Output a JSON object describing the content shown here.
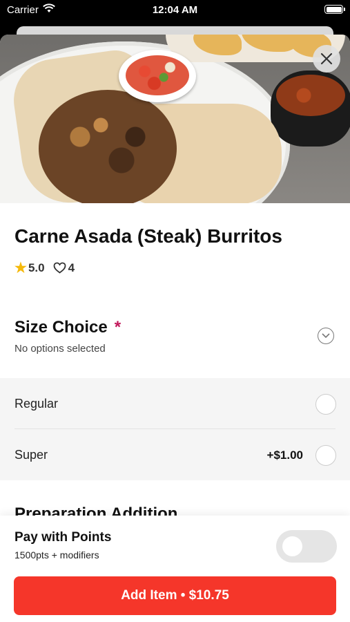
{
  "status_bar": {
    "carrier": "Carrier",
    "time": "12:04 AM"
  },
  "item": {
    "title": "Carne Asada (Steak) Burritos",
    "rating": "5.0",
    "likes": "4"
  },
  "size_choice": {
    "title": "Size Choice",
    "required_marker": "*",
    "subtitle": "No options selected",
    "options": [
      {
        "label": "Regular",
        "price": ""
      },
      {
        "label": "Super",
        "price": "+$1.00"
      }
    ]
  },
  "next_section": {
    "title": "Preparation Addition"
  },
  "pay_with_points": {
    "title": "Pay with Points",
    "subtitle": "1500pts + modifiers",
    "enabled": false
  },
  "add_button": {
    "label": "Add Item • $10.75"
  },
  "colors": {
    "accent": "#f5362a",
    "required": "#c2185b",
    "star": "#f5b90a"
  },
  "icons": [
    "wifi-icon",
    "battery-icon",
    "close-icon",
    "star-icon",
    "heart-icon",
    "chevron-down-icon"
  ]
}
